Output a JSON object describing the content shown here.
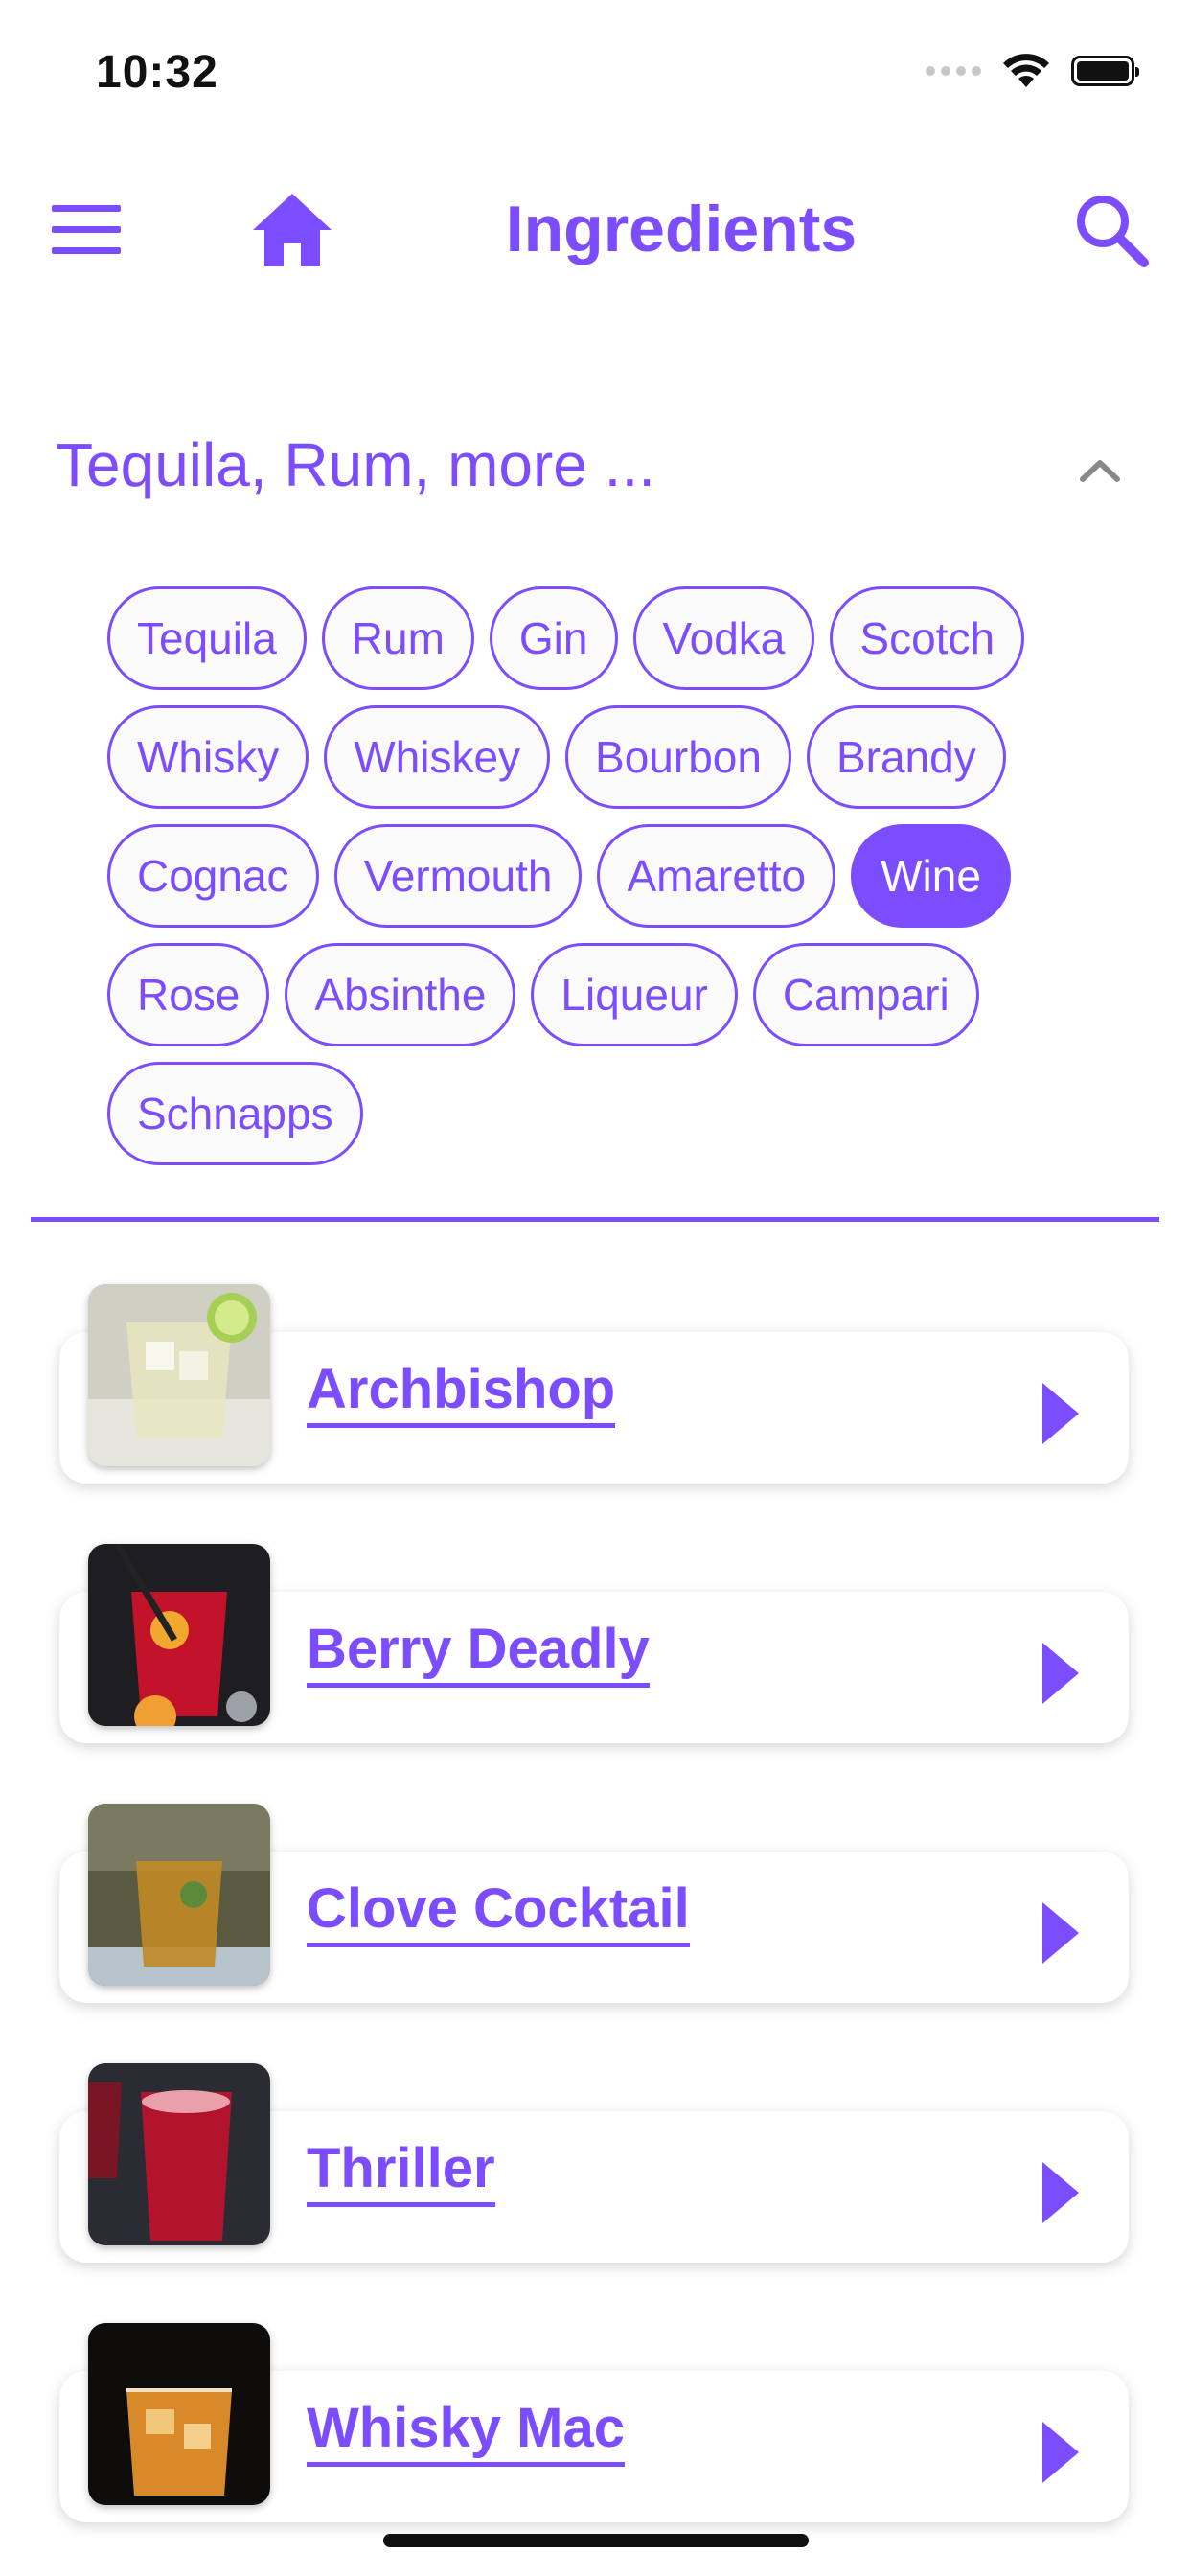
{
  "status_bar": {
    "time": "10:32"
  },
  "app_bar": {
    "title": "Ingredients",
    "menu_icon": "menu-icon",
    "home_icon": "home-icon",
    "search_icon": "search-icon"
  },
  "filter": {
    "title": "Tequila, Rum, more ...",
    "expanded": true,
    "chips": [
      {
        "label": "Tequila",
        "selected": false
      },
      {
        "label": "Rum",
        "selected": false
      },
      {
        "label": "Gin",
        "selected": false
      },
      {
        "label": "Vodka",
        "selected": false
      },
      {
        "label": "Scotch",
        "selected": false
      },
      {
        "label": "Whisky",
        "selected": false
      },
      {
        "label": "Whiskey",
        "selected": false
      },
      {
        "label": "Bourbon",
        "selected": false
      },
      {
        "label": "Brandy",
        "selected": false
      },
      {
        "label": "Cognac",
        "selected": false
      },
      {
        "label": "Vermouth",
        "selected": false
      },
      {
        "label": "Amaretto",
        "selected": false
      },
      {
        "label": "Wine",
        "selected": true
      },
      {
        "label": "Rose",
        "selected": false
      },
      {
        "label": "Absinthe",
        "selected": false
      },
      {
        "label": "Liqueur",
        "selected": false
      },
      {
        "label": "Campari",
        "selected": false
      },
      {
        "label": "Schnapps",
        "selected": false
      }
    ]
  },
  "drinks": [
    {
      "name": "Archbishop"
    },
    {
      "name": "Berry Deadly"
    },
    {
      "name": "Clove Cocktail"
    },
    {
      "name": "Thriller"
    },
    {
      "name": "Whisky Mac"
    }
  ],
  "colors": {
    "accent": "#7c4dff",
    "background": "#ffffff",
    "chip_background": "#fafafa"
  }
}
